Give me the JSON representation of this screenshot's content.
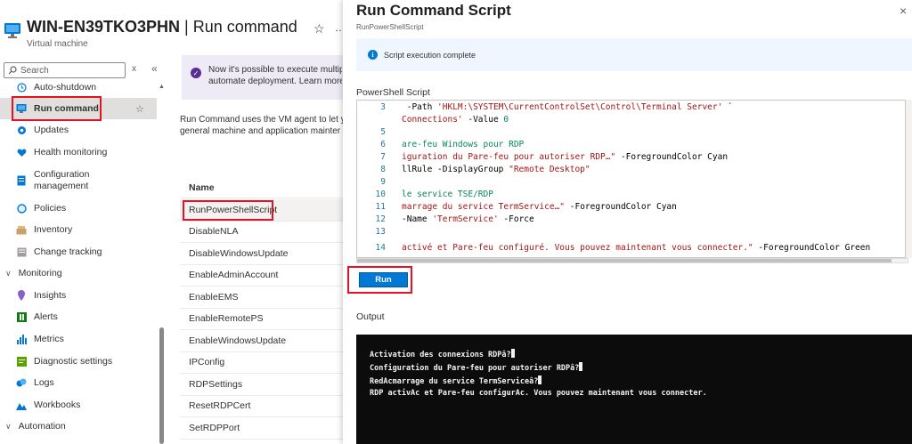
{
  "header": {
    "vm_name": "WIN-EN39TKO3PHN",
    "separator": " | ",
    "page": "Run command",
    "subtitle": "Virtual machine",
    "star": "☆",
    "more": "…"
  },
  "sidebar": {
    "search_placeholder": "Search",
    "clear": "x",
    "collapse": "«",
    "items": [
      {
        "label": "Auto-shutdown",
        "icon": "clock-icon"
      },
      {
        "label": "Run command",
        "icon": "run-command-icon",
        "selected": true
      },
      {
        "label": "Updates",
        "icon": "gear-icon"
      },
      {
        "label": "Health monitoring",
        "icon": "heart-icon"
      },
      {
        "label": "Configuration management",
        "label_line1": "Configuration",
        "label_line2": "management",
        "icon": "configuration-icon"
      },
      {
        "label": "Policies",
        "icon": "policy-icon"
      },
      {
        "label": "Inventory",
        "icon": "inventory-icon"
      },
      {
        "label": "Change tracking",
        "icon": "change-tracking-icon"
      }
    ],
    "groups": [
      {
        "label": "Monitoring",
        "expanded": true
      },
      {
        "label": "Automation",
        "expanded": true
      }
    ],
    "monitoring_items": [
      {
        "label": "Insights",
        "icon": "insights-icon"
      },
      {
        "label": "Alerts",
        "icon": "alerts-icon"
      },
      {
        "label": "Metrics",
        "icon": "metrics-icon"
      },
      {
        "label": "Diagnostic settings",
        "icon": "diagnostic-settings-icon"
      },
      {
        "label": "Logs",
        "icon": "logs-icon"
      },
      {
        "label": "Workbooks",
        "icon": "workbooks-icon"
      }
    ],
    "star": "☆"
  },
  "main": {
    "banner_line1": "Now it's possible to execute multiple",
    "banner_line2": "automate deployment. Learn more al",
    "desc_line1": "Run Command uses the VM agent to let y",
    "desc_line2": "general machine and application mainter",
    "name_header": "Name",
    "scripts": [
      "RunPowerShellScript",
      "DisableNLA",
      "DisableWindowsUpdate",
      "EnableAdminAccount",
      "EnableEMS",
      "EnableRemotePS",
      "EnableWindowsUpdate",
      "IPConfig",
      "RDPSettings",
      "ResetRDPCert",
      "SetRDPPort"
    ]
  },
  "blade": {
    "title": "Run Command Script",
    "subtitle": "RunPowerShellScript",
    "close": "×",
    "status": "Script execution complete",
    "script_label": "PowerShell Script",
    "run_label": "Run",
    "output_label": "Output",
    "code_lines": [
      {
        "n": "3",
        "a": " -Path ",
        "s": "'HKLM:\\SYSTEM\\CurrentControlSet\\Control\\Terminal Server'",
        "b": " `"
      },
      {
        "n": "",
        "s": "Connections'",
        "a": " -Value ",
        "num": "0"
      },
      {
        "n": "5",
        "a": ""
      },
      {
        "n": "6",
        "a": "are-feu Windows pour RDP"
      },
      {
        "n": "7",
        "s": "iguration du Pare-feu pour autoriser RDP…\"",
        "a": " -ForegroundColor Cyan"
      },
      {
        "n": "8",
        "a": "llRule -DisplayGroup ",
        "s": "\"Remote Desktop\""
      },
      {
        "n": "9",
        "a": ""
      },
      {
        "n": "10",
        "a": "le service TSE/RDP"
      },
      {
        "n": "11",
        "s": "marrage du service TermService…\"",
        "a": " -ForegroundColor Cyan"
      },
      {
        "n": "12",
        "a": "-Name ",
        "s": "'TermService'",
        "b": " -Force"
      },
      {
        "n": "13",
        "a": ""
      },
      {
        "n": "14",
        "s": "activé et Pare-feu configuré. Vous pouvez maintenant vous connecter.\"",
        "a": " -ForegroundColor Green"
      }
    ],
    "output_lines": [
      "Activation des connexions RDPâ?",
      "Configuration du Pare-feu pour autoriser RDPâ?",
      "RedAcmarrage du service TermServiceâ?",
      "RDP activAc et Pare-feu configurAc. Vous pouvez maintenant vous connecter."
    ]
  },
  "colors": {
    "accent": "#0078d4",
    "highlight": "#e81123",
    "console_bg": "#0c0c0c"
  }
}
